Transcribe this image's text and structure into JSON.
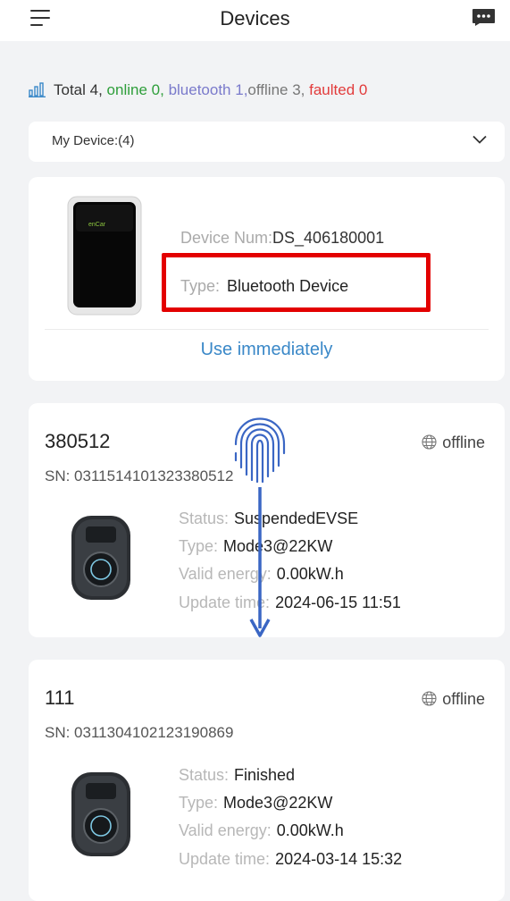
{
  "header": {
    "title": "Devices",
    "menu_icon": "menu-icon",
    "chat_icon": "chat-icon"
  },
  "summary": {
    "total": "Total 4,",
    "online": "online 0,",
    "bluetooth": "bluetooth 1,",
    "offline": "offline 3,",
    "faulted": "faulted 0",
    "colors": {
      "online": "#2e9e3a",
      "bluetooth": "#7a7acb",
      "faulted": "#e23b3b"
    }
  },
  "filter": {
    "label": "My Device:(4)"
  },
  "bluetooth_card": {
    "device_num_label": "Device Num:",
    "device_num_value": "DS_406180001",
    "type_label": "Type:",
    "type_value": "Bluetooth Device",
    "action": "Use immediately",
    "logo_text": "enCar"
  },
  "devices": [
    {
      "name": "380512",
      "sn": "SN: 031151410132338",
      "sn_tail": "0512",
      "net_status": "offline",
      "status_label": "Status:",
      "status_value": "SuspendedEVSE",
      "type_label": "Type:",
      "type_value": "Mode3@22KW",
      "energy_label": "Valid energy:",
      "energy_value": "0.00kW.h",
      "time_label": "Update time:",
      "time_value": "2024-06-15 11:51"
    },
    {
      "name": "111",
      "sn": "SN: 031130410212319",
      "sn_tail": "0869",
      "net_status": "offline",
      "status_label": "Status:",
      "status_value": "Finished",
      "type_label": "Type:",
      "type_value": "Mode3@22KW",
      "energy_label": "Valid energy:",
      "energy_value": "0.00kW.h",
      "time_label": "Update time:",
      "time_value": "2024-03-14 15:32"
    }
  ],
  "overlay": {
    "gesture": "swipe-down",
    "highlight_color": "#e30000",
    "gesture_color": "#3a66c4"
  }
}
